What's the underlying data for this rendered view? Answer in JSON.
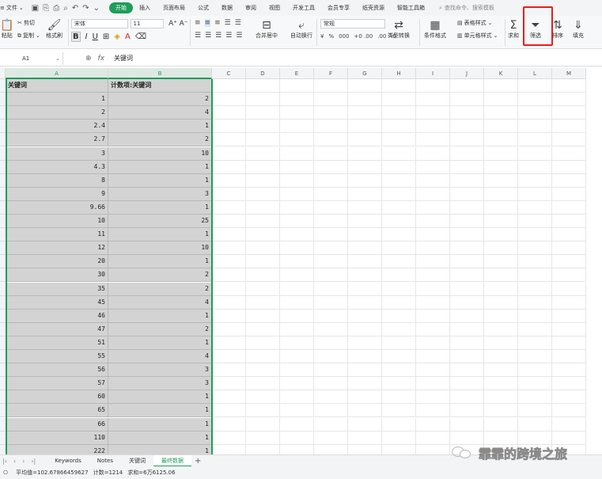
{
  "menubar": {
    "file_label": "文件",
    "tabs": [
      "开始",
      "插入",
      "页面布局",
      "公式",
      "数据",
      "审阅",
      "视图",
      "开发工具",
      "会员专享",
      "纸壳资源",
      "智能工具箱"
    ],
    "active_tab": "开始",
    "search_placeholder": "查找命令、搜索模板"
  },
  "ribbon": {
    "cut": "剪切",
    "copy": "复制",
    "paste": "粘贴",
    "format_painter": "格式刷",
    "font_name": "宋体",
    "font_size": "11",
    "bold": "B",
    "italic": "I",
    "underline": "U",
    "merge_center": "合并居中",
    "wrap_text": "自动换行",
    "number_format": "常规",
    "currency_symbol": "¥",
    "percent_symbol": "%",
    "thousands_symbol": "000",
    "inc_decimal_symbol": "+0 .00",
    "dec_decimal_symbol": ".00 →0",
    "type_convert": "类型转换",
    "conditional_format": "条件格式",
    "table_style": "表格样式",
    "cell_style": "单元格样式",
    "sum": "求和",
    "filter": "筛选",
    "sort": "排序",
    "fill": "填充"
  },
  "formula_bar": {
    "cell_ref": "A1",
    "content": "关键词"
  },
  "columns": [
    "A",
    "B",
    "C",
    "D",
    "E",
    "F",
    "G",
    "H",
    "I",
    "J",
    "K",
    "L",
    "M"
  ],
  "rows": [
    {
      "a": "关键词",
      "b": "计数项:关键词",
      "header": true
    },
    {
      "a": "1",
      "b": "2"
    },
    {
      "a": "2",
      "b": "4"
    },
    {
      "a": "2.4",
      "b": "1"
    },
    {
      "a": "2.7",
      "b": "2"
    },
    {
      "a": "3",
      "b": "10"
    },
    {
      "a": "4.3",
      "b": "1"
    },
    {
      "a": "8",
      "b": "1"
    },
    {
      "a": "9",
      "b": "3"
    },
    {
      "a": "9.66",
      "b": "1"
    },
    {
      "a": "10",
      "b": "25"
    },
    {
      "a": "11",
      "b": "1"
    },
    {
      "a": "12",
      "b": "10"
    },
    {
      "a": "20",
      "b": "1"
    },
    {
      "a": "30",
      "b": "2"
    },
    {
      "a": "35",
      "b": "2"
    },
    {
      "a": "45",
      "b": "4"
    },
    {
      "a": "46",
      "b": "1"
    },
    {
      "a": "47",
      "b": "2"
    },
    {
      "a": "51",
      "b": "1"
    },
    {
      "a": "55",
      "b": "4"
    },
    {
      "a": "56",
      "b": "3"
    },
    {
      "a": "57",
      "b": "3"
    },
    {
      "a": "60",
      "b": "1"
    },
    {
      "a": "65",
      "b": "1"
    },
    {
      "a": "66",
      "b": "1"
    },
    {
      "a": "110",
      "b": "1"
    },
    {
      "a": "222",
      "b": "1"
    }
  ],
  "sheet_tabs": [
    "Keywords",
    "Notes",
    "关键词",
    "最终数据"
  ],
  "active_sheet": "最终数据",
  "status": {
    "average": "平均值=102.67866459627",
    "count": "计数=1214",
    "sum": "求和=6万6125.06"
  },
  "watermark": "霏霏的跨境之旅"
}
